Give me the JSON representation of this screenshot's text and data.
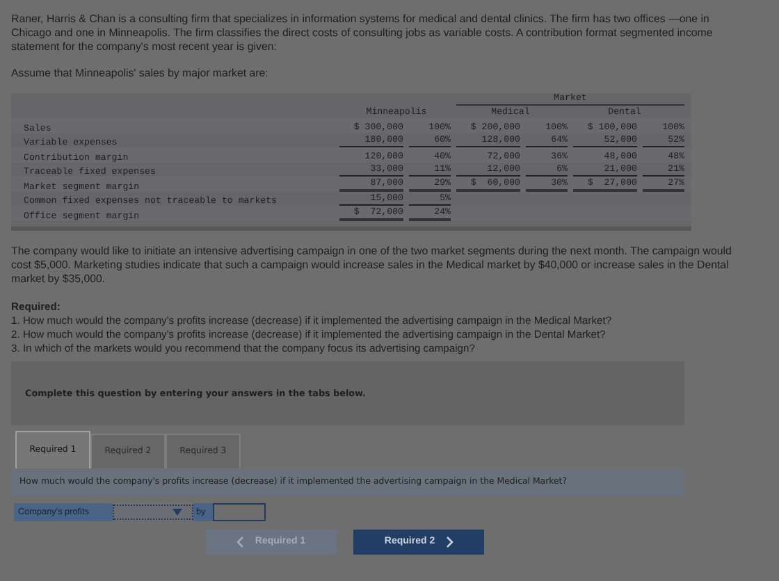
{
  "intro": [
    "Raner, Harris & Chan is a consulting firm that specializes in information systems for medical and dental clinics. The firm has two offices —one in Chicago and one in Minneapolis. The firm classifies the direct costs of consulting jobs as variable costs. A contribution format segmented income statement for the company's most recent year is given:",
    "Assume that Minneapolis' sales by major market are:"
  ],
  "table": {
    "group_header": "Market",
    "columns": [
      "Minneapolis",
      "Medical",
      "Dental"
    ],
    "rows": [
      {
        "label": "Sales",
        "kind": "plain",
        "cells": [
          {
            "amount": "$ 300,000",
            "percent": "100%"
          },
          {
            "amount": "$ 200,000",
            "percent": "100%"
          },
          {
            "amount": "$ 100,000",
            "percent": "100%"
          }
        ]
      },
      {
        "label": "Variable expenses",
        "kind": "underlined",
        "cells": [
          {
            "amount": "180,000",
            "percent": "60%"
          },
          {
            "amount": "128,000",
            "percent": "64%"
          },
          {
            "amount": "52,000",
            "percent": "52%"
          }
        ]
      },
      {
        "label": "Contribution margin",
        "kind": "plain",
        "cells": [
          {
            "amount": "120,000",
            "percent": "40%"
          },
          {
            "amount": "72,000",
            "percent": "36%"
          },
          {
            "amount": "48,000",
            "percent": "48%"
          }
        ]
      },
      {
        "label": "Traceable fixed expenses",
        "kind": "underlined",
        "cells": [
          {
            "amount": "33,000",
            "percent": "11%"
          },
          {
            "amount": "12,000",
            "percent": "6%"
          },
          {
            "amount": "21,000",
            "percent": "21%"
          }
        ]
      },
      {
        "label": "Market segment margin",
        "kind": "total",
        "cells": [
          {
            "amount": "87,000",
            "percent": "29%"
          },
          {
            "amount": "$  60,000",
            "percent": "30%"
          },
          {
            "amount": "$  27,000",
            "percent": "27%"
          }
        ]
      },
      {
        "label": "Common fixed expenses not traceable to markets",
        "kind": "underlined",
        "cells": [
          {
            "amount": "15,000",
            "percent": "5%"
          }
        ]
      },
      {
        "label": "Office segment margin",
        "kind": "total",
        "cells": [
          {
            "amount": "$  72,000",
            "percent": "24%"
          }
        ]
      }
    ]
  },
  "scenario": "The company would like to initiate an intensive advertising campaign in one of the two market segments during the next month. The campaign would cost $5,000. Marketing studies indicate that such a campaign would increase sales in the Medical market by $40,000 or increase sales in the Dental market by $35,000.",
  "required_title": "Required:",
  "questions": [
    "1. How much would the company's profits increase (decrease) if it implemented the advertising campaign in the Medical Market?",
    "2. How much would the company's profits increase (decrease) if it implemented the advertising campaign in the Dental Market?",
    "3. In which of the markets would you recommend that the company focus its advertising campaign?"
  ],
  "instruction": "Complete this question by entering your answers in the tabs below.",
  "tabs": [
    {
      "label": "Required 1",
      "selected": true
    },
    {
      "label": "Required 2",
      "selected": false
    },
    {
      "label": "Required 3",
      "selected": false
    }
  ],
  "tab_question": "How much would the company's profits increase (decrease) if it implemented the advertising campaign in the Medical Market?",
  "answer": {
    "label": "Company's profits",
    "by": "by"
  },
  "nav": [
    {
      "label": "Required 1",
      "kind": "prev",
      "disabled": true
    },
    {
      "label": "Required 2",
      "kind": "next",
      "disabled": false
    }
  ]
}
